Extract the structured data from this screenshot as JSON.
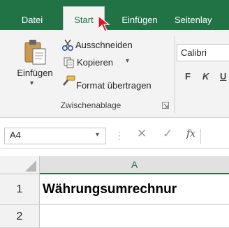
{
  "ribbon": {
    "tabs": [
      {
        "label": "Datei",
        "active": false
      },
      {
        "label": "Start",
        "active": true
      },
      {
        "label": "Einfügen",
        "active": false
      },
      {
        "label": "Seitenlay",
        "active": false
      }
    ],
    "clipboard": {
      "paste_label": "Einfügen",
      "cut_label": "Ausschneiden",
      "copy_label": "Kopieren",
      "format_painter_label": "Format übertragen",
      "group_label": "Zwischenablage"
    },
    "font": {
      "font_name": "Calibri",
      "bold_label": "F",
      "italic_label": "K",
      "underline_label": "U"
    }
  },
  "formula_bar": {
    "name_box": "A4",
    "cancel_symbol": "✕",
    "enter_symbol": "✓",
    "fx_label": "fx",
    "formula": ""
  },
  "sheet": {
    "column_headers": [
      "A"
    ],
    "rows": [
      {
        "number": "1",
        "cell_a": "Währungsumrechnur"
      },
      {
        "number": "2",
        "cell_a": ""
      }
    ]
  },
  "colors": {
    "accent": "#217346",
    "cursor": "#e81123"
  }
}
